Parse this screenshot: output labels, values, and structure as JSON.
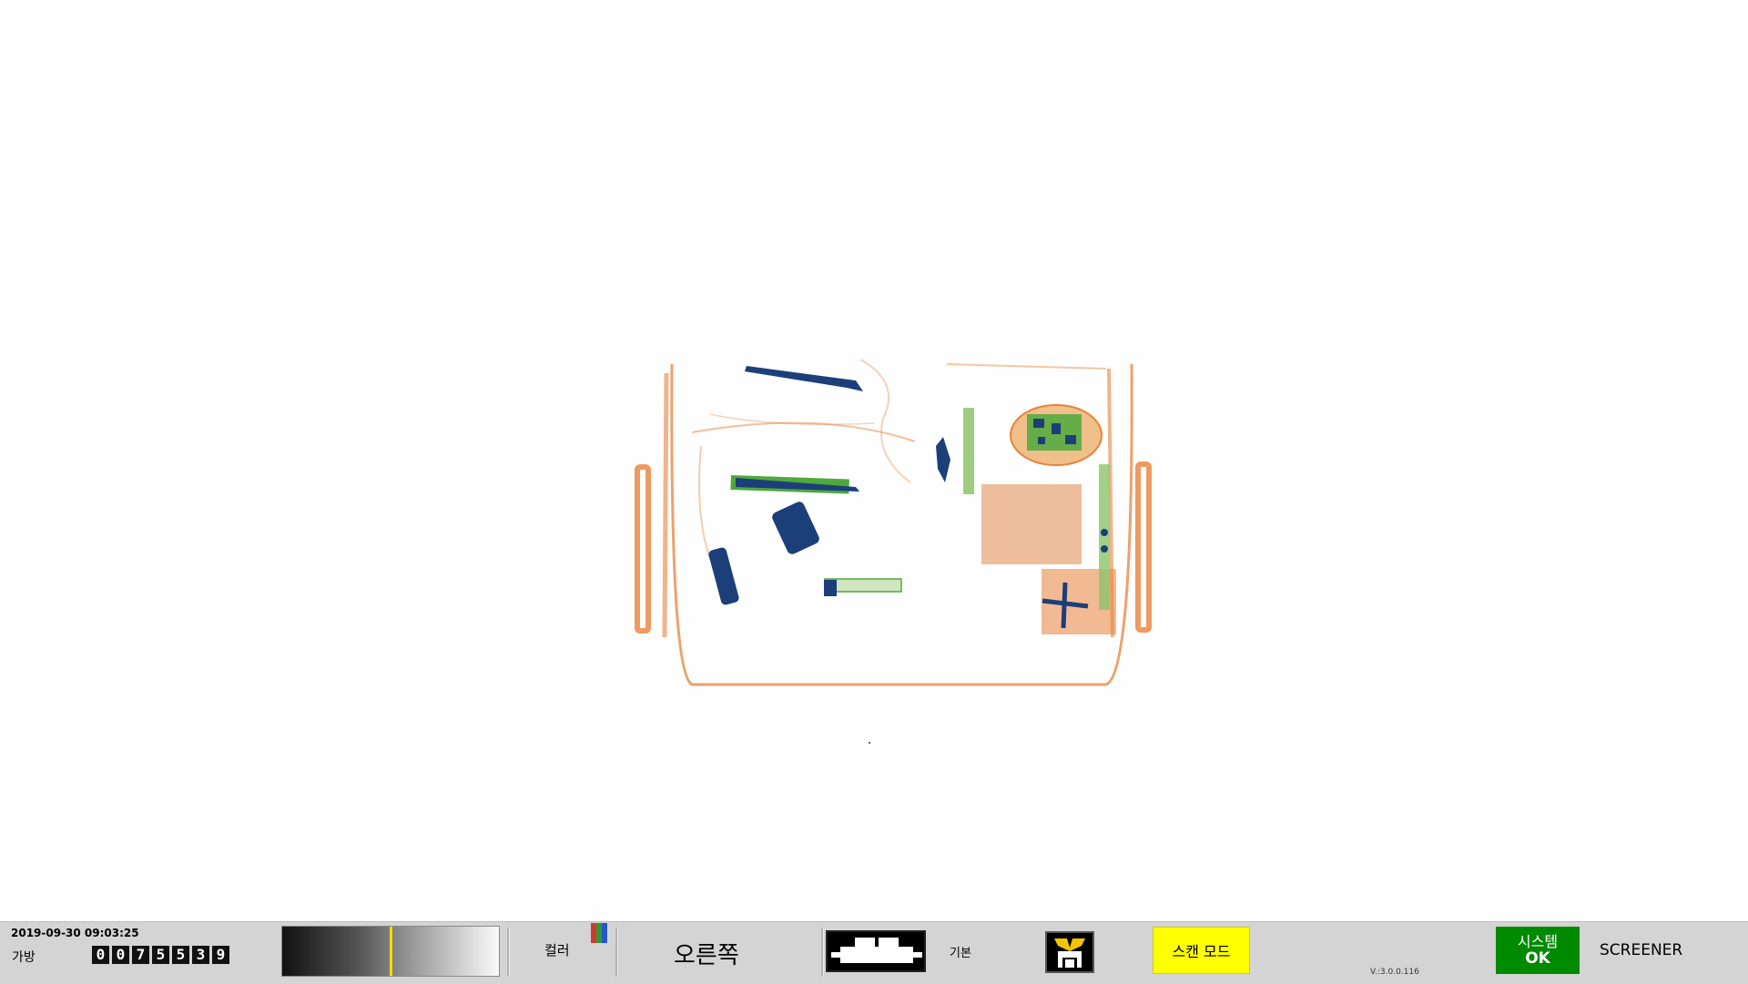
{
  "status_bar": {
    "datetime": "2019-09-30 09:03:25",
    "bag_label": "가방",
    "bag_count_digits": [
      "0",
      "0",
      "7",
      "5",
      "5",
      "3",
      "9"
    ],
    "gray_level": 0.5,
    "color_label": "컬러",
    "color_bar_colors": [
      "#d43a2a",
      "#2c9a3a",
      "#2a55c8"
    ],
    "direction_label": "오른쪽",
    "mode_label": "기본",
    "scan_mode_label": "스캔 모드",
    "version": "V.:3.0.0.116",
    "system_label": "시스템",
    "system_status": "OK",
    "user_role": "SCREENER"
  },
  "icons": {
    "belt": "conveyor-belt-icon",
    "save": "save-image-icon",
    "color_bars": "rgb-bars-icon"
  },
  "colors": {
    "organic": "#e8823a",
    "inorganic": "#4ea83c",
    "metal": "#1c3f7a",
    "scan_mode_bg": "#ffff00",
    "system_ok_bg": "#008a00"
  }
}
